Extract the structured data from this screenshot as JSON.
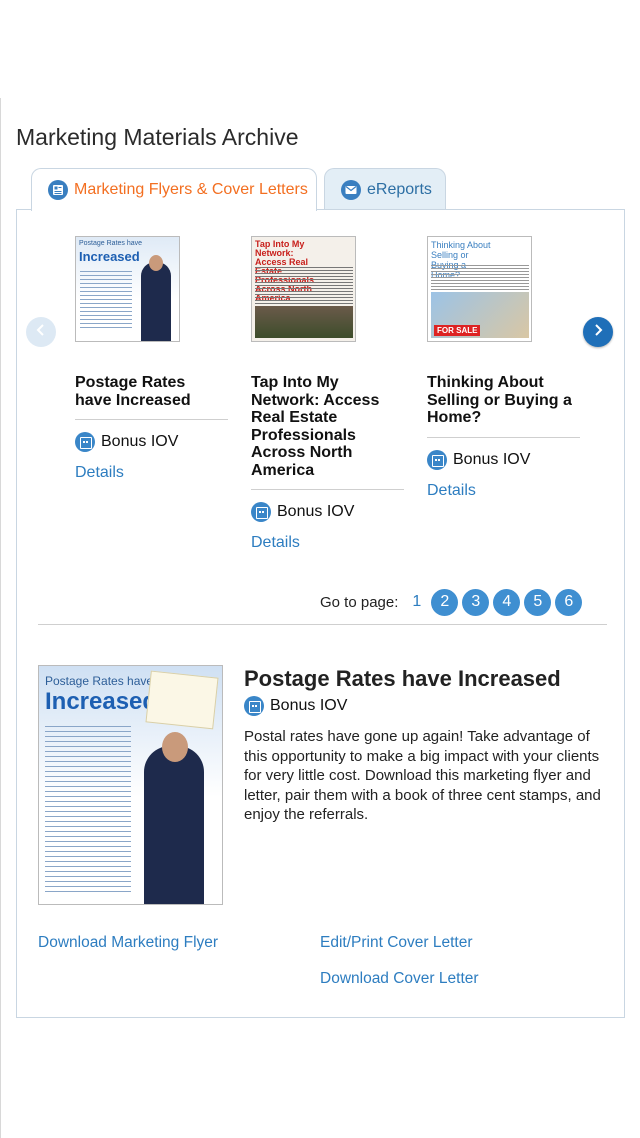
{
  "page": {
    "title": "Marketing Materials Archive"
  },
  "tabs": [
    {
      "label": "Marketing Flyers & Cover Letters",
      "active": true,
      "icon": "newsletter-icon"
    },
    {
      "label": "eReports",
      "active": false,
      "icon": "email-icon"
    }
  ],
  "carousel": {
    "prev_icon": "chevron-left-icon",
    "next_icon": "chevron-right-icon",
    "cards": [
      {
        "title": "Postage Rates have Increased",
        "badge": "Bonus IOV",
        "details_label": "Details",
        "thumb": {
          "header": "Postage Rates have",
          "headline": "Increased"
        }
      },
      {
        "title": "Tap Into My Network: Access Real Estate Professionals Across North America",
        "badge": "Bonus IOV",
        "details_label": "Details",
        "thumb": {
          "header": "Tap Into My Network: Access Real Estate Professionals Across North America"
        }
      },
      {
        "title": "Thinking About Selling or Buying a Home?",
        "badge": "Bonus IOV",
        "details_label": "Details",
        "thumb": {
          "header": "Thinking About Selling or Buying a Home?",
          "sign": "FOR SALE"
        }
      }
    ]
  },
  "pagination": {
    "label": "Go to page:",
    "current": "1",
    "pages": [
      "2",
      "3",
      "4",
      "5",
      "6"
    ]
  },
  "detail": {
    "title": "Postage Rates have Increased",
    "badge": "Bonus IOV",
    "description": "Postal rates have gone up again! Take advantage of this opportunity to make a big impact with your clients for very little cost. Download this marketing flyer and letter, pair them with a book of three cent stamps, and enjoy the referrals.",
    "image": {
      "header": "Postage Rates have",
      "headline": "Increased"
    }
  },
  "links": {
    "download_flyer": "Download Marketing Flyer",
    "edit_print_letter": "Edit/Print Cover Letter",
    "download_letter": "Download Cover Letter"
  }
}
